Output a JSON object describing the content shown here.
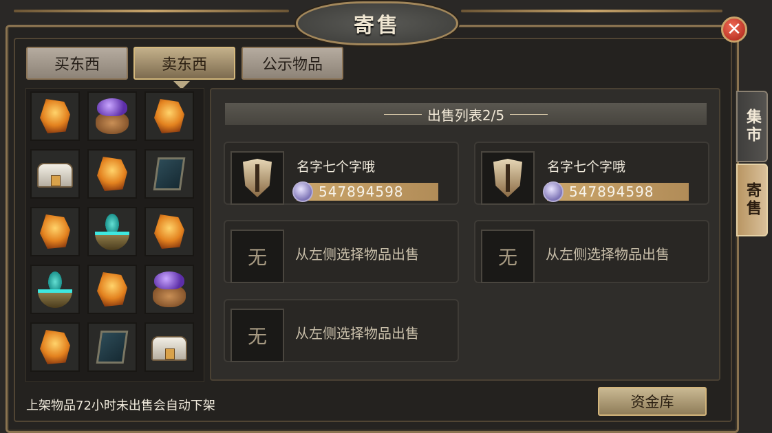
{
  "title": "寄售",
  "close_label": "✕",
  "tabs": [
    {
      "label": "买东西",
      "active": false
    },
    {
      "label": "卖东西",
      "active": true
    },
    {
      "label": "公示物品",
      "active": false
    }
  ],
  "side_tabs": [
    {
      "label": "集市",
      "active": false
    },
    {
      "label": "寄售",
      "active": true
    }
  ],
  "inventory": [
    {
      "icon": "ore-icon"
    },
    {
      "icon": "pouch-icon"
    },
    {
      "icon": "ore-icon"
    },
    {
      "icon": "chest-icon"
    },
    {
      "icon": "ore-icon"
    },
    {
      "icon": "book-icon"
    },
    {
      "icon": "ore-icon"
    },
    {
      "icon": "bowl-icon"
    },
    {
      "icon": "ore-icon"
    },
    {
      "icon": "bowl-icon"
    },
    {
      "icon": "ore-icon"
    },
    {
      "icon": "pouch-icon"
    },
    {
      "icon": "ore-icon"
    },
    {
      "icon": "book-icon"
    },
    {
      "icon": "chest-icon"
    }
  ],
  "sale_list": {
    "header": "出售列表2/5",
    "listings": [
      {
        "name": "名字七个字哦",
        "price": "547894598",
        "icon": "shield-icon"
      },
      {
        "name": "名字七个字哦",
        "price": "547894598",
        "icon": "shield-icon"
      }
    ],
    "empty_slots": [
      {
        "glyph": "无",
        "text": "从左侧选择物品出售"
      },
      {
        "glyph": "无",
        "text": "从左侧选择物品出售"
      },
      {
        "glyph": "无",
        "text": "从左侧选择物品出售"
      }
    ]
  },
  "footer": {
    "notice": "上架物品72小时未出售会自动下架",
    "fund_button": "资金库"
  },
  "colors": {
    "accent_gold": "#caa56a",
    "panel_bg": "#2f2d2a",
    "text_light": "#f1ebdd"
  }
}
